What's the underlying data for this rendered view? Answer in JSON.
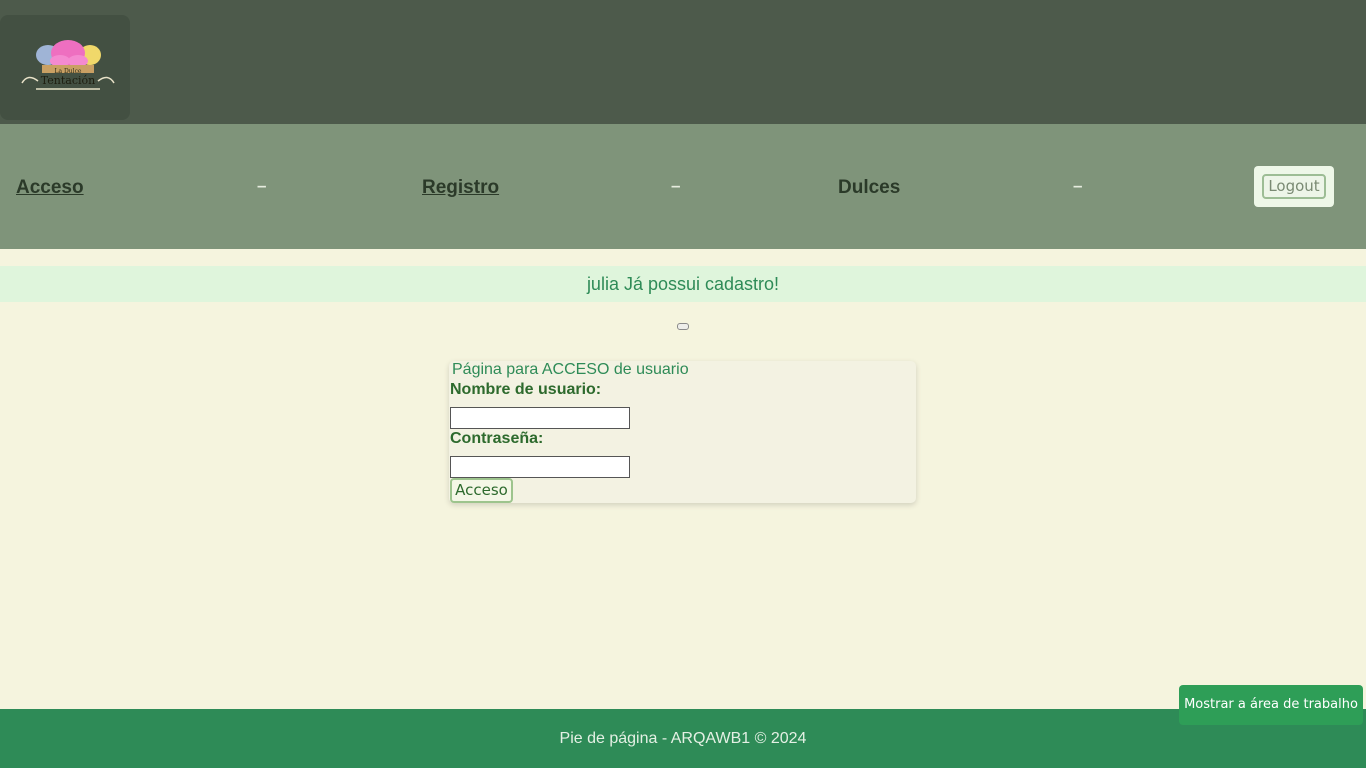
{
  "header": {
    "logo_alt": "La Dulce Tentación",
    "logo_line1": "La Dulce",
    "logo_line2": "Tentación"
  },
  "nav": {
    "items": [
      {
        "label": "Acceso"
      },
      {
        "label": "Registro"
      },
      {
        "label": "Dulces"
      }
    ],
    "separator": "–",
    "logout_label": "Logout"
  },
  "message": "julia Já possui cadastro!",
  "login": {
    "title": "Página para ACCESO de usuario",
    "username_label": "Nombre de usuario:",
    "username_value": "",
    "password_label": "Contraseña:",
    "password_value": "",
    "submit_label": "Acceso"
  },
  "footer": {
    "text": "Pie de página - ARQAWB1 © 2024"
  },
  "desktop_button_label": "Mostrar a área de trabalho",
  "colors": {
    "header_bg": "#4d5a4b",
    "nav_bg": "#7f947a",
    "page_bg": "#f5f4de",
    "footer_bg": "#2e8b57",
    "accent": "#2e8b57"
  }
}
